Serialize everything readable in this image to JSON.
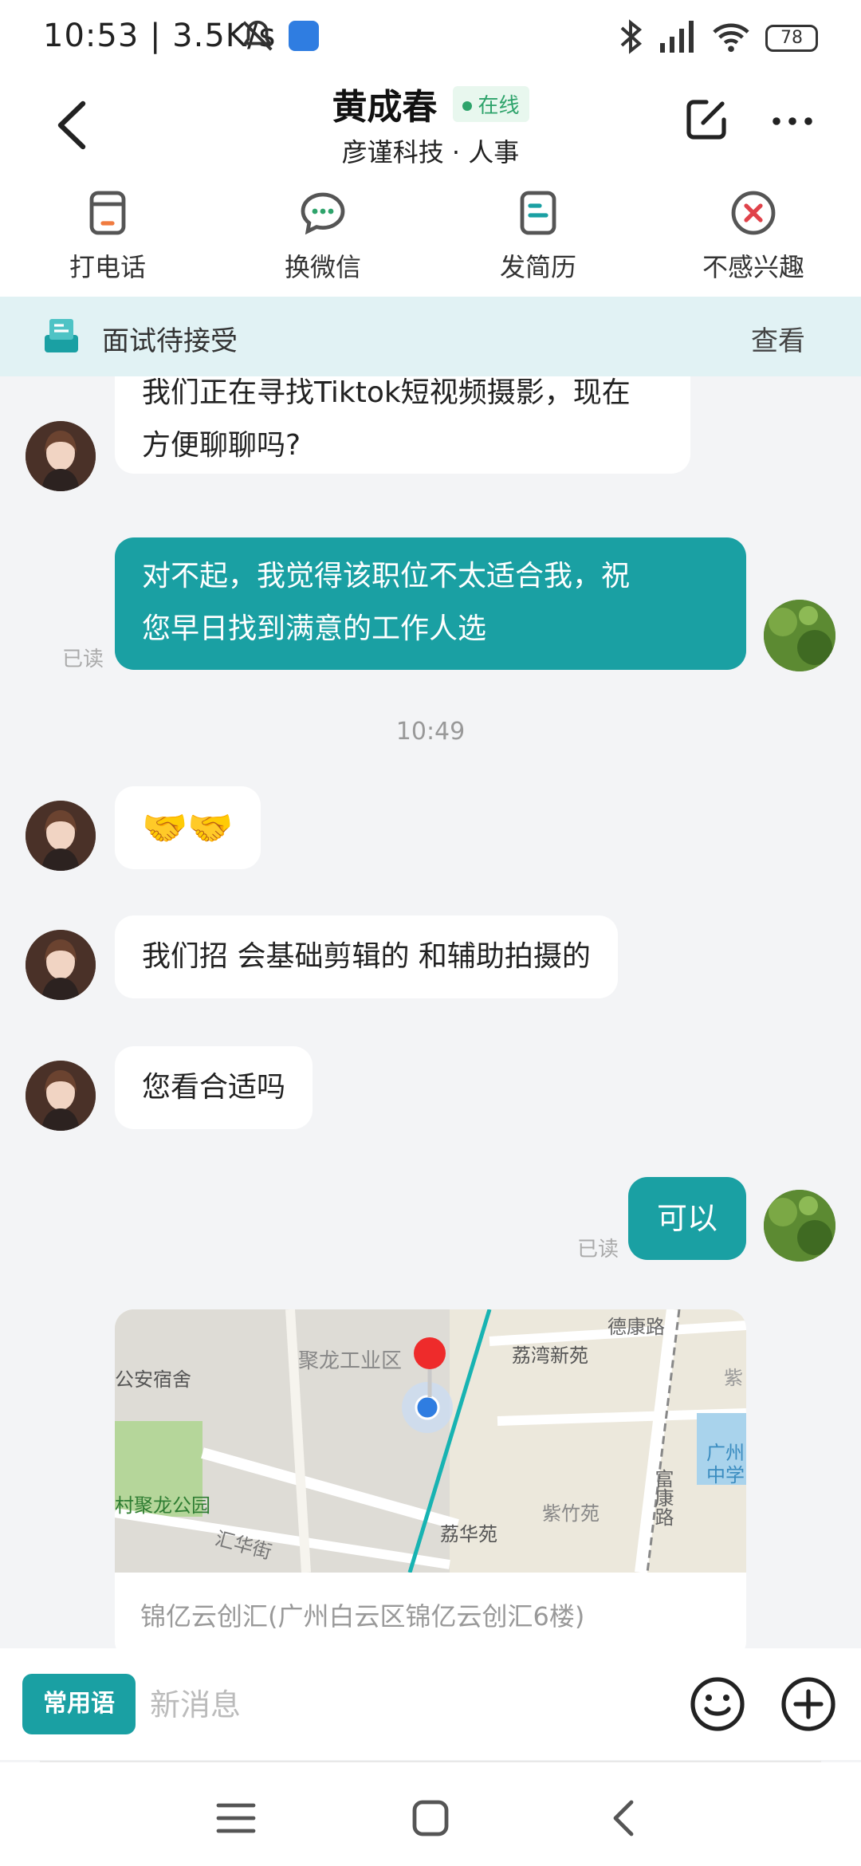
{
  "status_bar": {
    "time": "10:53 | 3.5K/s",
    "battery": "78"
  },
  "header": {
    "contact_name": "黄成春",
    "online_status": "在线",
    "company": "彦谨科技 · 人事"
  },
  "actions": [
    {
      "label": "打电话",
      "icon": "phone-icon"
    },
    {
      "label": "换微信",
      "icon": "wechat-icon"
    },
    {
      "label": "发简历",
      "icon": "resume-icon"
    },
    {
      "label": "不感兴趣",
      "icon": "not-interested-icon"
    }
  ],
  "interview_banner": {
    "text": "面试待接受",
    "action": "查看"
  },
  "messages": {
    "m1_line1": "我们正在寻找Tiktok短视频摄影，现在",
    "m1_line2": "方便聊聊吗?",
    "m2_line1": "对不起，我觉得该职位不太适合我，祝",
    "m2_line2": "您早日找到满意的工作人选",
    "m2_status": "已读",
    "time_divider": "10:49",
    "m3_emoji": "🤝🤝",
    "m4": "我们招 会基础剪辑的 和辅助拍摄的",
    "m5": "您看合适吗",
    "m6": "可以",
    "m6_status": "已读"
  },
  "location": {
    "map_labels": {
      "juLong": "聚龙工业区",
      "liwan": "荔湾新苑",
      "dekang": "德康路",
      "gongan": "公安宿舍",
      "zi": "紫",
      "guangzhou": "广州",
      "zhongxue": "中学",
      "park": "村聚龙公园",
      "huihua": "汇华街",
      "lihua": "荔华苑",
      "zizhu": "紫竹苑",
      "fukang": "富康路"
    },
    "address": "锦亿云创汇(广州白云区锦亿云创汇6楼)"
  },
  "input_bar": {
    "phrases_label": "常用语",
    "placeholder": "新消息"
  },
  "colors": {
    "accent": "#1aa0a3",
    "banner_bg": "#e1f2f4",
    "chat_bg": "#f3f4f6",
    "online": "#2ea36b",
    "reject": "#e0424a"
  }
}
